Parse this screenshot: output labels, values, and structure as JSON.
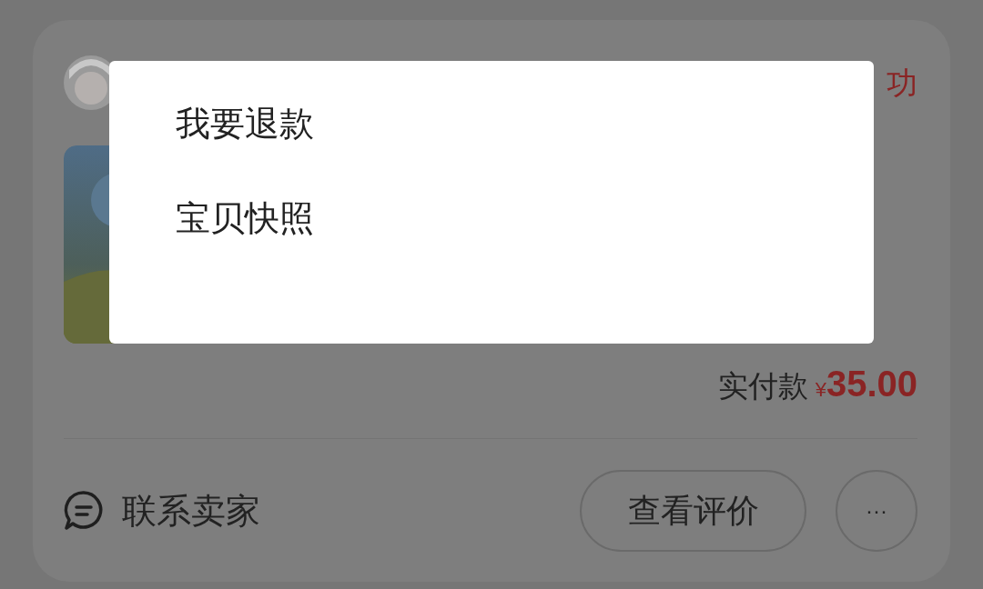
{
  "order": {
    "status": "功",
    "payment_label": "实付款",
    "currency": "¥",
    "amount": "35.00"
  },
  "popup_menu": [
    {
      "label": "我要退款"
    },
    {
      "label": "宝贝快照"
    }
  ],
  "footer": {
    "contact": "联系卖家",
    "buttons": [
      {
        "kind": "pill",
        "label": "查看评价"
      },
      {
        "kind": "circle",
        "label": "···"
      }
    ]
  }
}
